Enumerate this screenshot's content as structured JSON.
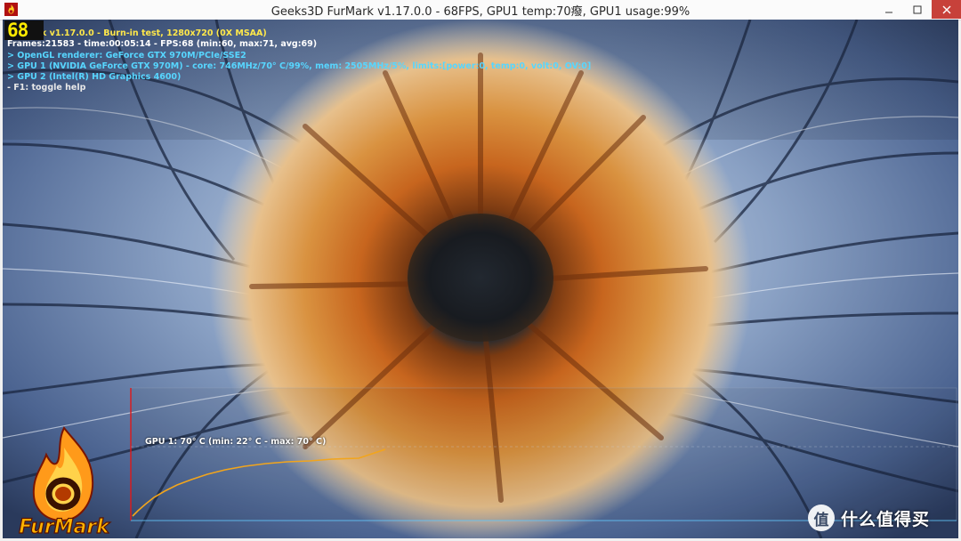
{
  "window": {
    "title": "Geeks3D FurMark v1.17.0.0 - 68FPS, GPU1 temp:70癈, GPU1 usage:99%",
    "app_icon": "furmark-flame-icon",
    "controls": {
      "minimize": "minimize-icon",
      "maximize": "maximize-icon",
      "close": "close-icon"
    }
  },
  "osd": {
    "fps_counter": "68",
    "line1": "FurMark v1.17.0.0 - Burn-in test, 1280x720 (0X MSAA)",
    "line2": "Frames:21583 - time:00:05:14 - FPS:68 (min:60, max:71, avg:69)",
    "line3": "> OpenGL renderer: GeForce GTX 970M/PCIe/SSE2",
    "line4": "> GPU 1 (NVIDIA GeForce GTX 970M) - core: 746MHz/70° C/99%, mem: 2505MHz/5%, limits:[power:0, temp:0, volt:0, OV:0]",
    "line5": "> GPU 2 (Intel(R) HD Graphics 4600)",
    "line6": "- F1: toggle help",
    "colors": {
      "title_yellow": "#ffe84a",
      "stat_white": "#ffffff",
      "gpu_cyan": "#57d6ff"
    }
  },
  "temperature_graph": {
    "title": "GPU 1: 70° C (min: 22° C - max: 70° C)",
    "min_temp": 22,
    "max_temp": 70,
    "current_temp": 70,
    "curve_color": "#f2a51c",
    "marker_color": "#e01818"
  },
  "logo": {
    "text": "FurMark",
    "icon": "furmark-flame-logo"
  },
  "watermark": {
    "icon": "zhi-de-mai-icon",
    "text": "什么值得买"
  }
}
